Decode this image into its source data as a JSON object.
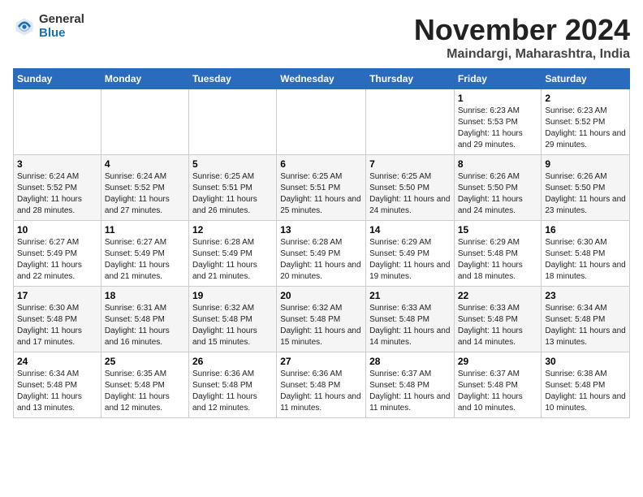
{
  "header": {
    "logo_general": "General",
    "logo_blue": "Blue",
    "month_title": "November 2024",
    "location": "Maindargi, Maharashtra, India"
  },
  "days_of_week": [
    "Sunday",
    "Monday",
    "Tuesday",
    "Wednesday",
    "Thursday",
    "Friday",
    "Saturday"
  ],
  "weeks": [
    [
      {
        "day": "",
        "info": ""
      },
      {
        "day": "",
        "info": ""
      },
      {
        "day": "",
        "info": ""
      },
      {
        "day": "",
        "info": ""
      },
      {
        "day": "",
        "info": ""
      },
      {
        "day": "1",
        "info": "Sunrise: 6:23 AM\nSunset: 5:53 PM\nDaylight: 11 hours and 29 minutes."
      },
      {
        "day": "2",
        "info": "Sunrise: 6:23 AM\nSunset: 5:52 PM\nDaylight: 11 hours and 29 minutes."
      }
    ],
    [
      {
        "day": "3",
        "info": "Sunrise: 6:24 AM\nSunset: 5:52 PM\nDaylight: 11 hours and 28 minutes."
      },
      {
        "day": "4",
        "info": "Sunrise: 6:24 AM\nSunset: 5:52 PM\nDaylight: 11 hours and 27 minutes."
      },
      {
        "day": "5",
        "info": "Sunrise: 6:25 AM\nSunset: 5:51 PM\nDaylight: 11 hours and 26 minutes."
      },
      {
        "day": "6",
        "info": "Sunrise: 6:25 AM\nSunset: 5:51 PM\nDaylight: 11 hours and 25 minutes."
      },
      {
        "day": "7",
        "info": "Sunrise: 6:25 AM\nSunset: 5:50 PM\nDaylight: 11 hours and 24 minutes."
      },
      {
        "day": "8",
        "info": "Sunrise: 6:26 AM\nSunset: 5:50 PM\nDaylight: 11 hours and 24 minutes."
      },
      {
        "day": "9",
        "info": "Sunrise: 6:26 AM\nSunset: 5:50 PM\nDaylight: 11 hours and 23 minutes."
      }
    ],
    [
      {
        "day": "10",
        "info": "Sunrise: 6:27 AM\nSunset: 5:49 PM\nDaylight: 11 hours and 22 minutes."
      },
      {
        "day": "11",
        "info": "Sunrise: 6:27 AM\nSunset: 5:49 PM\nDaylight: 11 hours and 21 minutes."
      },
      {
        "day": "12",
        "info": "Sunrise: 6:28 AM\nSunset: 5:49 PM\nDaylight: 11 hours and 21 minutes."
      },
      {
        "day": "13",
        "info": "Sunrise: 6:28 AM\nSunset: 5:49 PM\nDaylight: 11 hours and 20 minutes."
      },
      {
        "day": "14",
        "info": "Sunrise: 6:29 AM\nSunset: 5:49 PM\nDaylight: 11 hours and 19 minutes."
      },
      {
        "day": "15",
        "info": "Sunrise: 6:29 AM\nSunset: 5:48 PM\nDaylight: 11 hours and 18 minutes."
      },
      {
        "day": "16",
        "info": "Sunrise: 6:30 AM\nSunset: 5:48 PM\nDaylight: 11 hours and 18 minutes."
      }
    ],
    [
      {
        "day": "17",
        "info": "Sunrise: 6:30 AM\nSunset: 5:48 PM\nDaylight: 11 hours and 17 minutes."
      },
      {
        "day": "18",
        "info": "Sunrise: 6:31 AM\nSunset: 5:48 PM\nDaylight: 11 hours and 16 minutes."
      },
      {
        "day": "19",
        "info": "Sunrise: 6:32 AM\nSunset: 5:48 PM\nDaylight: 11 hours and 15 minutes."
      },
      {
        "day": "20",
        "info": "Sunrise: 6:32 AM\nSunset: 5:48 PM\nDaylight: 11 hours and 15 minutes."
      },
      {
        "day": "21",
        "info": "Sunrise: 6:33 AM\nSunset: 5:48 PM\nDaylight: 11 hours and 14 minutes."
      },
      {
        "day": "22",
        "info": "Sunrise: 6:33 AM\nSunset: 5:48 PM\nDaylight: 11 hours and 14 minutes."
      },
      {
        "day": "23",
        "info": "Sunrise: 6:34 AM\nSunset: 5:48 PM\nDaylight: 11 hours and 13 minutes."
      }
    ],
    [
      {
        "day": "24",
        "info": "Sunrise: 6:34 AM\nSunset: 5:48 PM\nDaylight: 11 hours and 13 minutes."
      },
      {
        "day": "25",
        "info": "Sunrise: 6:35 AM\nSunset: 5:48 PM\nDaylight: 11 hours and 12 minutes."
      },
      {
        "day": "26",
        "info": "Sunrise: 6:36 AM\nSunset: 5:48 PM\nDaylight: 11 hours and 12 minutes."
      },
      {
        "day": "27",
        "info": "Sunrise: 6:36 AM\nSunset: 5:48 PM\nDaylight: 11 hours and 11 minutes."
      },
      {
        "day": "28",
        "info": "Sunrise: 6:37 AM\nSunset: 5:48 PM\nDaylight: 11 hours and 11 minutes."
      },
      {
        "day": "29",
        "info": "Sunrise: 6:37 AM\nSunset: 5:48 PM\nDaylight: 11 hours and 10 minutes."
      },
      {
        "day": "30",
        "info": "Sunrise: 6:38 AM\nSunset: 5:48 PM\nDaylight: 11 hours and 10 minutes."
      }
    ]
  ]
}
